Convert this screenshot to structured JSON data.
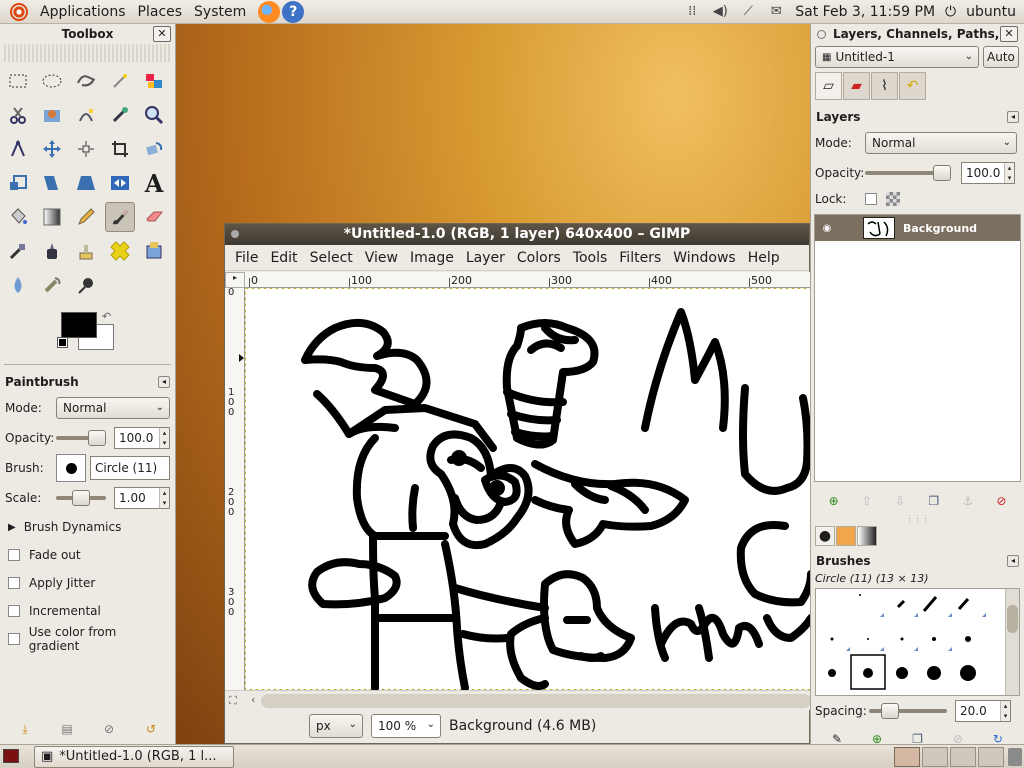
{
  "top_panel": {
    "menus": [
      "Applications",
      "Places",
      "System"
    ],
    "clock": "Sat Feb  3, 11:59 PM",
    "user": "ubuntu"
  },
  "toolbox": {
    "title": "Toolbox",
    "options_title": "Paintbrush",
    "mode_label": "Mode:",
    "mode_value": "Normal",
    "opacity_label": "Opacity:",
    "opacity_value": "100.0",
    "opacity_level": 1.0,
    "brush_label": "Brush:",
    "brush_value": "Circle (11)",
    "scale_label": "Scale:",
    "scale_value": "1.00",
    "scale_level": 0.5,
    "dynamics_label": "Brush Dynamics",
    "checks": [
      "Fade out",
      "Apply Jitter",
      "Incremental",
      "Use color from gradient"
    ],
    "fg_color": "#000000",
    "bg_color": "#ffffff"
  },
  "image_window": {
    "title": "*Untitled-1.0 (RGB, 1 layer) 640x400 – GIMP",
    "menus": [
      "File",
      "Edit",
      "Select",
      "View",
      "Image",
      "Layer",
      "Colors",
      "Tools",
      "Filters",
      "Windows",
      "Help"
    ],
    "ruler_h": [
      "0",
      "100",
      "200",
      "300",
      "400",
      "500"
    ],
    "ruler_v": [
      "0",
      "1\n0\n0",
      "2\n0\n0",
      "3\n0\n0"
    ],
    "unit": "px",
    "zoom": "100 %",
    "status": "Background (4.6 MB)"
  },
  "layers_panel": {
    "title": "Layers, Channels, Paths, U",
    "image_combo": "Untitled-1",
    "auto_label": "Auto",
    "section_title": "Layers",
    "mode_label": "Mode:",
    "mode_value": "Normal",
    "opacity_label": "Opacity:",
    "opacity_value": "100.0",
    "opacity_level": 1.0,
    "lock_label": "Lock:",
    "layer_name": "Background",
    "brushes_title": "Brushes",
    "brush_info": "Circle (11) (13 × 13)",
    "spacing_label": "Spacing:",
    "spacing_value": "20.0",
    "spacing_level": 0.2
  },
  "taskbar": {
    "task": "*Untitled-1.0 (RGB, 1 l..."
  }
}
